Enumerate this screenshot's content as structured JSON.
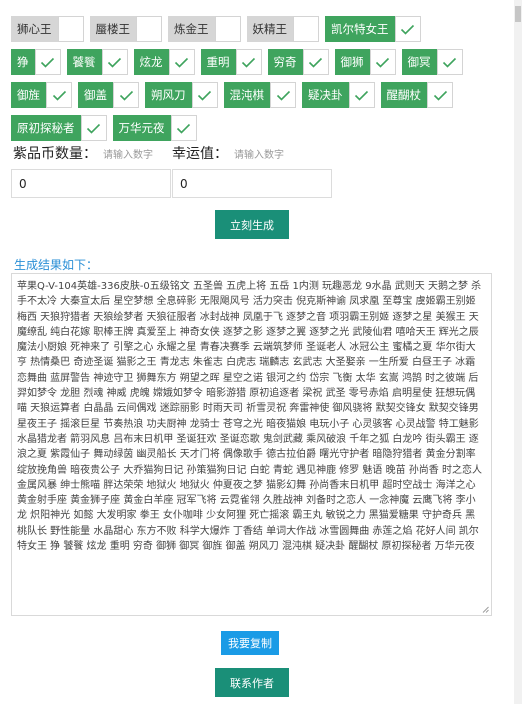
{
  "tags": [
    [
      {
        "label": "狮心王",
        "checked": false
      },
      {
        "label": "蜃楼王",
        "checked": false
      },
      {
        "label": "炼金王",
        "checked": false
      },
      {
        "label": "妖精王",
        "checked": false
      },
      {
        "label": "凯尔特女王",
        "checked": true
      }
    ],
    [
      {
        "label": "狰",
        "checked": true
      },
      {
        "label": "饕餮",
        "checked": true
      },
      {
        "label": "炫龙",
        "checked": true
      },
      {
        "label": "重明",
        "checked": true
      },
      {
        "label": "穷奇",
        "checked": true
      },
      {
        "label": "御狮",
        "checked": true
      },
      {
        "label": "御冥",
        "checked": true
      }
    ],
    [
      {
        "label": "御旌",
        "checked": true
      },
      {
        "label": "御盖",
        "checked": true
      },
      {
        "label": "朔风刀",
        "checked": true
      },
      {
        "label": "混沌棋",
        "checked": true
      },
      {
        "label": "疑决卦",
        "checked": true
      },
      {
        "label": "醒醐杖",
        "checked": true
      }
    ],
    [
      {
        "label": "原初探秘者",
        "checked": true
      },
      {
        "label": "万华元夜",
        "checked": true
      }
    ]
  ],
  "purple_coins": {
    "label": "紫品币数量：",
    "placeholder": "请输入数字",
    "value": "0"
  },
  "luck": {
    "label": "幸运值：",
    "placeholder": "请输入数字",
    "value": "0"
  },
  "generate_label": "立刻生成",
  "result_title": "生成结果如下：",
  "result_text": "苹果Q-V-104英雄-336皮肤-0五级铭文 五圣兽 五虎上将 五岳 1内测 玩趣恶龙 9水晶 武则天 天鹅之梦 杀手不太冷 大秦宣太后 星空梦想 全息碎影 无限飓风号 活力突击 倪克斯神谕 凤求凰 至尊宝 虞姬霸王别姬 梅西 天狼狩猎者 天狼绘梦者 天狼征服者 冰封战神 凤凰于飞 逐梦之音 项羽霸王别姬 逐梦之星 美猴王 天魔缭乱 纯白花嫁 职棒王牌 真爱至上 神奇女侠 逐梦之影 逐梦之翼 逐梦之光 武陵仙君 嘻哈天王 辉光之辰 魔法小厨娘 死神来了 引擎之心 永耀之星 青春决赛季 云端筑梦师 圣诞老人 冰冠公主 蜜橘之夏 华尔街大亨 热情桑巴 奇迹圣诞 猫影之王 青龙志 朱雀志 白虎志 瑞麟志 玄武志 大圣娶亲 一生所爱 白昼王子 冰霜恋舞曲 蓝屏警告 神迹守卫 狮舞东方 朔望之晖 星空之诺 银河之约 岱宗 飞衡 太华 玄嵩 鸿鹄 时之彼端 后羿如梦令 龙胆 烈魂 神威 虎魄 嫦娥如梦令 暗影游猎 原初追逐者 梁祝 武圣 零号赤焰 启明星使 狂想玩偶喵 天狼运算者 白晶晶 云间偶戏 迷踪丽影 时雨天司 祈雪灵祝 奔雷神使 御风骁将 默契交锋女 默契交锋男 星夜王子 摇滚巨星 节奏热浪 功夫厨神 龙骑士 苍穹之光 暗夜猫娘 电玩小子 心灵骇客 心灵战警 特工魅影 水晶猎龙者 箭羽风息 吕布末日机甲 圣诞狂欢 圣诞恋歌 鬼剑武藏 乘风破浪 千年之狐 白龙吟 街头霸王 逐浪之夏 紫霞仙子 舞动绿茵 幽灵船长 天才门将 偶像歌手 德古拉伯爵 曙光守护者 暗隐狩猎者 黄金分割率 绽放挽角兽 暗夜贵公子 大乔猫狗日记 孙策猫狗日记 白蛇 青蛇 遇见神鹿 修罗 魅语 晚苗 孙尚香 时之恋人 金属风暴 绅士熊喵 胖达荣荣 地狱火 地狱火 仲夏夜之梦 猫影幻舞 孙尚香末日机甲 超时空战士 海洋之心 黄金射手座 黄金狮子座 黄金白羊座 冠军飞将 云霓雀翎 久胜战神 刘备时之恋人 一念神魔 云鹰飞将 李小龙 炽阳神光 如懿 大发明家 拳王 女仆咖啡 少女阿狸 死亡摇滚 霸王丸 敏锐之力 黑猫爱糖果 守护奇兵 黑桃队长 野性能量 水晶甜心 东方不败 科学大爆炸 丁香结 单词大作战 冰雪圆舞曲 赤莲之焰 花好人间 凯尔特女王 狰 饕餮 炫龙 重明 穷奇 御狮 御冥 御旌 御盖 朔风刀 混沌棋 疑决卦 醒醐杖 原初探秘者 万华元夜",
  "copy_label": "我要复制",
  "contact_label": "联系作者"
}
